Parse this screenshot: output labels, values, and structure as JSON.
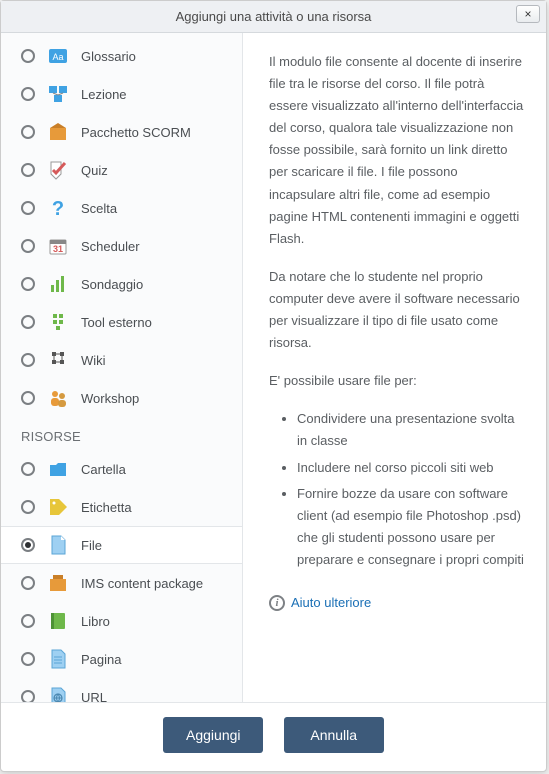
{
  "dialog": {
    "title": "Aggiungi una attività o una risorsa",
    "close_label": "×"
  },
  "activities": [
    {
      "id": "glossario",
      "label": "Glossario",
      "icon": "glossary",
      "selected": false
    },
    {
      "id": "lezione",
      "label": "Lezione",
      "icon": "lesson",
      "selected": false
    },
    {
      "id": "scorm",
      "label": "Pacchetto SCORM",
      "icon": "scorm",
      "selected": false
    },
    {
      "id": "quiz",
      "label": "Quiz",
      "icon": "quiz",
      "selected": false
    },
    {
      "id": "scelta",
      "label": "Scelta",
      "icon": "choice",
      "selected": false
    },
    {
      "id": "scheduler",
      "label": "Scheduler",
      "icon": "calendar",
      "selected": false
    },
    {
      "id": "sondaggio",
      "label": "Sondaggio",
      "icon": "survey",
      "selected": false
    },
    {
      "id": "toolesterno",
      "label": "Tool esterno",
      "icon": "external",
      "selected": false
    },
    {
      "id": "wiki",
      "label": "Wiki",
      "icon": "wiki",
      "selected": false
    },
    {
      "id": "workshop",
      "label": "Workshop",
      "icon": "workshop",
      "selected": false
    }
  ],
  "resources_title": "RISORSE",
  "resources": [
    {
      "id": "cartella",
      "label": "Cartella",
      "icon": "folder",
      "selected": false
    },
    {
      "id": "etichetta",
      "label": "Etichetta",
      "icon": "label",
      "selected": false
    },
    {
      "id": "file",
      "label": "File",
      "icon": "file",
      "selected": true
    },
    {
      "id": "ims",
      "label": "IMS content package",
      "icon": "ims",
      "selected": false
    },
    {
      "id": "libro",
      "label": "Libro",
      "icon": "book",
      "selected": false
    },
    {
      "id": "pagina",
      "label": "Pagina",
      "icon": "page",
      "selected": false
    },
    {
      "id": "url",
      "label": "URL",
      "icon": "url",
      "selected": false
    }
  ],
  "description": {
    "p1": "Il modulo file consente al docente di inserire file tra le risorse del corso. Il file potrà essere visualizzato all'interno dell'interfaccia del corso, qualora tale visualizzazione non fosse possibile, sarà fornito un link diretto per scaricare il file. I file possono incapsulare altri file, come ad esempio pagine HTML contenenti immagini e oggetti Flash.",
    "p2": "Da notare che lo studente nel proprio computer deve avere il software necessario per visualizzare il tipo di file usato come risorsa.",
    "p3": "E' possibile usare file per:",
    "bullets": [
      "Condividere una presentazione svolta in classe",
      "Includere nel corso piccoli siti web",
      "Fornire bozze da usare con software client (ad esempio file Photoshop .psd) che gli studenti possono usare per preparare e consegnare i propri compiti"
    ],
    "help_label": "Aiuto ulteriore"
  },
  "buttons": {
    "add": "Aggiungi",
    "cancel": "Annulla"
  },
  "icons": {
    "glossary": "#3fa2e3",
    "lesson": "#3fa2e3",
    "scorm": "#e79a3a",
    "quiz": "#d55a5a",
    "choice": "#3fa2e3",
    "calendar": "#d55a5a",
    "survey": "#6eb84a",
    "external": "#6eb84a",
    "wiki": "#555",
    "workshop": "#e79a3a",
    "folder": "#3fa2e3",
    "label": "#e7c63a",
    "file": "#9ed0f2",
    "ims": "#e79a3a",
    "book": "#6eb84a",
    "page": "#9ed0f2",
    "url": "#9ed0f2"
  }
}
